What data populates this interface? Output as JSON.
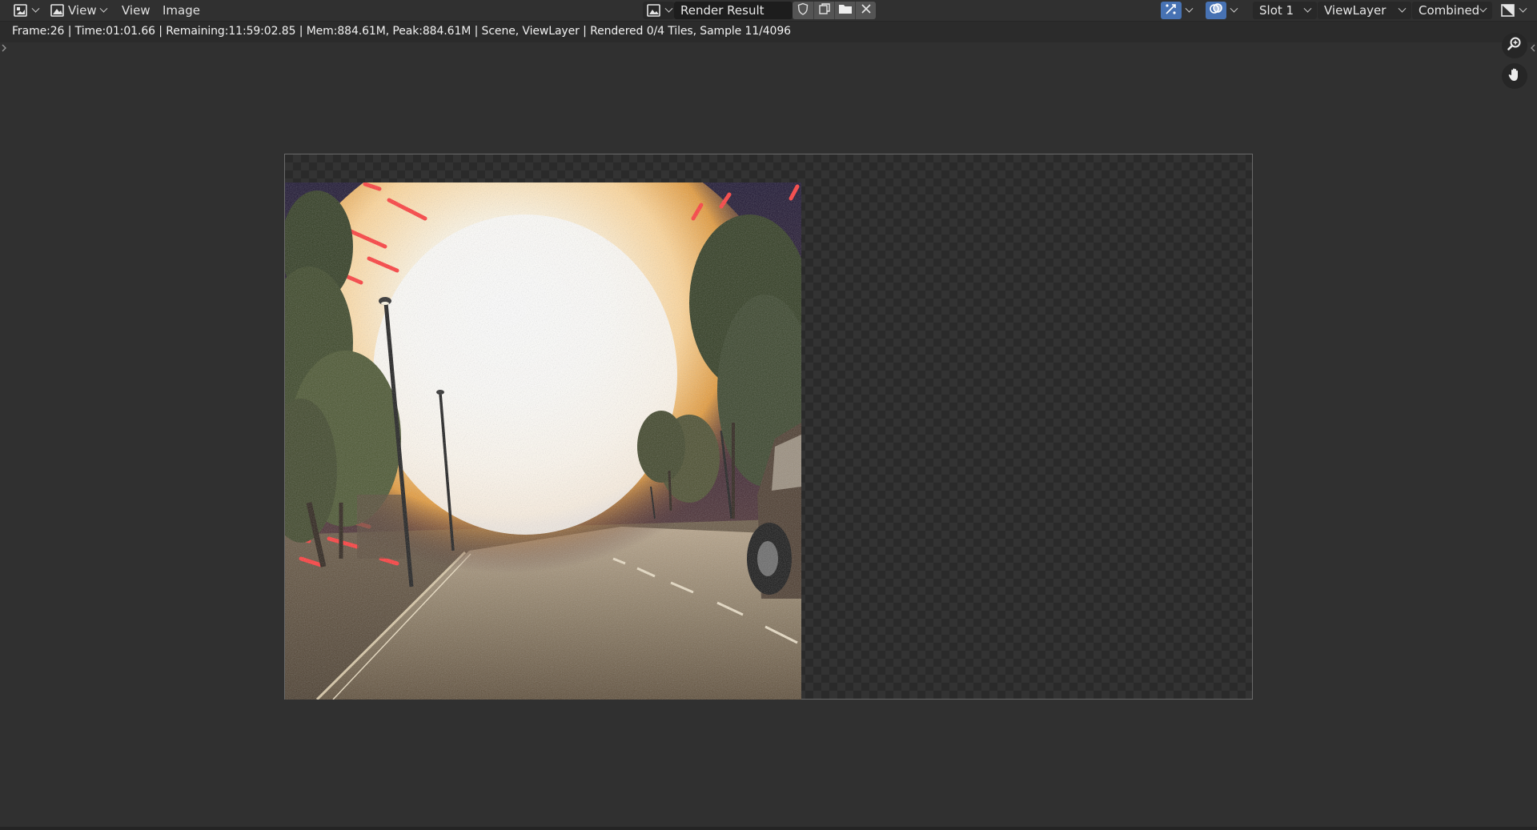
{
  "header": {
    "editor_type_icon": "image-editor-icon",
    "view_mode_icon": "image-view-icon",
    "view_mode_label": "View",
    "menus": [
      "View",
      "Image"
    ],
    "image_browse_icon": "image-browse-icon",
    "image_name": "Render Result",
    "image_buttons": [
      "fake-user-shield-icon",
      "duplicate-image-icon",
      "open-folder-icon",
      "close-icon"
    ],
    "gizmo_icon": "gizmo-icon",
    "overlay_icon": "overlay-icon",
    "slot": "Slot 1",
    "view_layer": "ViewLayer",
    "pass": "Combined",
    "display_channels_icon": "display-channels-icon"
  },
  "status": {
    "text": "Frame:26 | Time:01:01.66 | Remaining:11:59:02.85 | Mem:884.61M, Peak:884.61M | Scene, ViewLayer | Rendered 0/4 Tiles, Sample 11/4096"
  },
  "tools": {
    "zoom_icon": "zoom-icon",
    "pan_icon": "hand-pan-icon"
  },
  "colors": {
    "background": "#303030",
    "header": "#303030",
    "field": "#1d1d1d",
    "accent": "#4772b3"
  }
}
